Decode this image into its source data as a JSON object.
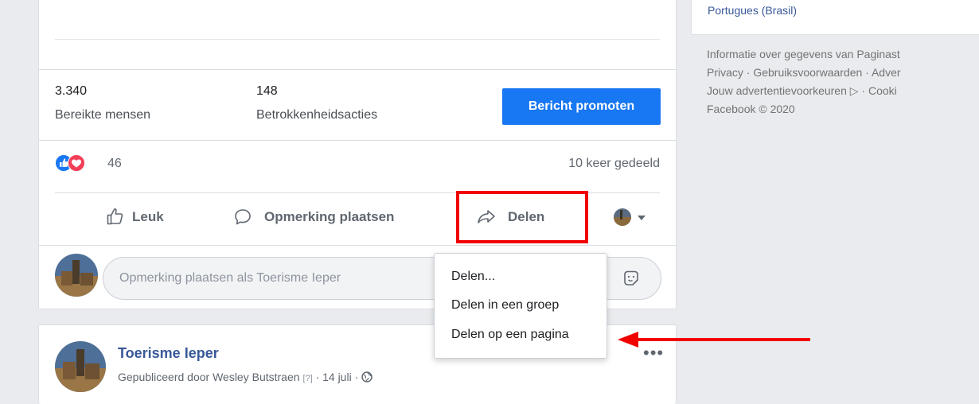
{
  "sidebar": {
    "language_link": "Portugues (Brasil)",
    "footer": {
      "line1": "Informatie over gegevens van Paginast",
      "line2": "Privacy · Gebruiksvoorwaarden · Adver",
      "line3": "Jouw advertentievoorkeuren ▷ · Cooki",
      "line4": "Facebook © 2020"
    }
  },
  "post": {
    "stats": [
      {
        "value": "3.340",
        "label": "Bereikte mensen"
      },
      {
        "value": "148",
        "label": "Betrokkenheidsacties"
      }
    ],
    "promote_label": "Bericht promoten",
    "reaction_count": "46",
    "share_count_text": "10 keer gedeeld",
    "actions": {
      "like": "Leuk",
      "comment": "Opmerking plaatsen",
      "share": "Delen"
    },
    "comment_placeholder": "Opmerking plaatsen als Toerisme Ieper"
  },
  "share_menu": {
    "items": [
      "Delen...",
      "Delen in een groep",
      "Delen op een pagina"
    ]
  },
  "next_post": {
    "page_name": "Toerisme Ieper",
    "meta_prefix": "Gepubliceerd door Wesley Butstraen",
    "meta_help": "[?]",
    "meta_date": "· 14 juli ·"
  },
  "colors": {
    "accent": "#1877f2",
    "annotation": "#f20000",
    "like": "#1877f2",
    "love": "#f33e58"
  }
}
